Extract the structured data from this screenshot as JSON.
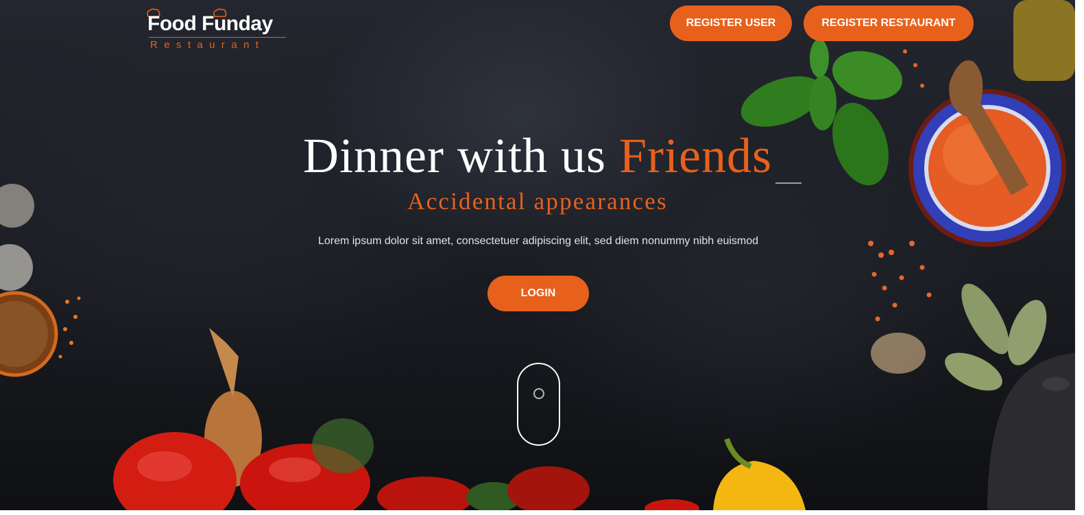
{
  "logo": {
    "title": "Food Funday",
    "subtitle": "Restaurant"
  },
  "header": {
    "register_user_label": "REGISTER USER",
    "register_restaurant_label": "REGISTER RESTAURANT"
  },
  "hero": {
    "headline_main": "Dinner with us ",
    "headline_accent": "Friends",
    "subheadline": "Accidental appearances",
    "description": "Lorem ipsum dolor sit amet, consectetuer adipiscing elit, sed diem nonummy nibh euismod",
    "login_label": "LOGIN"
  },
  "colors": {
    "accent": "#e8611c",
    "background": "#1a1c22",
    "text": "#ffffff"
  },
  "icons": {
    "logo_decoration": "chef-hat-icon",
    "scroll_indicator": "mouse-scroll-icon"
  }
}
